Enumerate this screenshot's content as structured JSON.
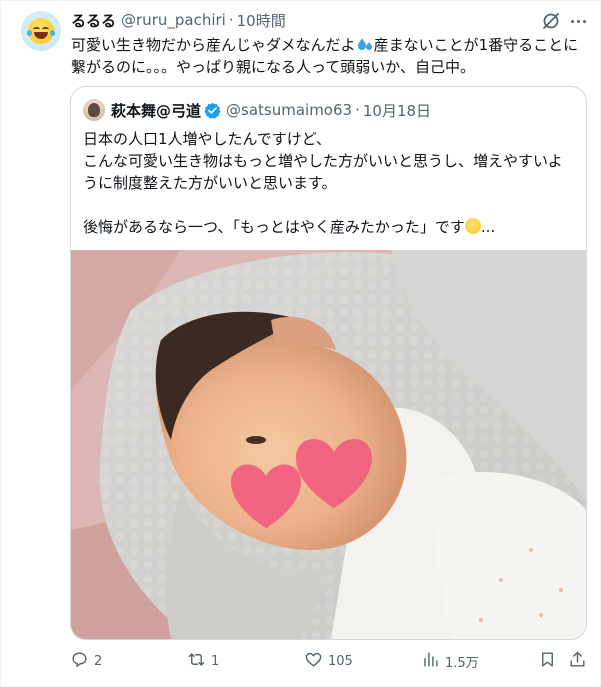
{
  "tweet": {
    "author_name": "るるる",
    "author_handle": "@ruru_pachiri",
    "separator": "·",
    "time": "10時間",
    "text_lines": [
      "可愛い生き物だから産んじゃダメなんだよ",
      "産まないことが1番守ることに",
      "繋がるのに。。。やっぱり親になる人って頭弱いか、自己中。"
    ]
  },
  "quoted": {
    "author_name": "萩本舞@弓道",
    "author_handle": "@satsumaimo63",
    "separator": "·",
    "date": "10月18日",
    "text_lines": [
      "日本の人口1人増やしたんですけど、",
      "こんな可愛い生き物はもっと増やした方がいいと思うし、増えやすいよ",
      "うに制度整えた方がいいと思います。",
      "",
      "後悔があるなら一つ、「もっとはやく産みたかった」です",
      "..."
    ],
    "image_alt": "Photo of a newborn baby swaddled in a gray muslin blanket, face partially covered by two pink hearts"
  },
  "actions": {
    "reply_count": "2",
    "repost_count": "1",
    "like_count": "105",
    "views_count": "1.5万"
  },
  "icons": [
    "reply-icon",
    "repost-icon",
    "like-icon",
    "views-icon",
    "bookmark-icon",
    "share-icon",
    "grok-icon",
    "more-icon",
    "verified-badge-icon"
  ],
  "colors": {
    "text": "#0f1419",
    "secondary": "#536471",
    "border": "#cfd9de",
    "verified": "#1d9bf0",
    "heart_blur": "#f06080"
  }
}
